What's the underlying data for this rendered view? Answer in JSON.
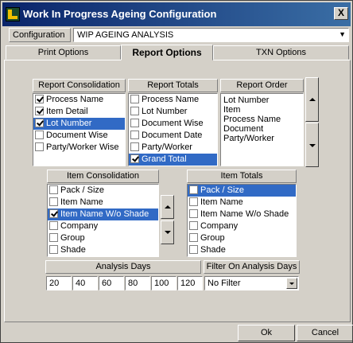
{
  "window": {
    "title": "Work In Progress Ageing Configuration",
    "close_glyph": "X"
  },
  "config": {
    "label": "Configuration",
    "value": "WIP AGEING ANALYSIS"
  },
  "tabs": [
    {
      "label": "Print Options"
    },
    {
      "label": "Report Options",
      "active": true
    },
    {
      "label": "TXN Options"
    }
  ],
  "report_consolidation": {
    "title": "Report Consolidation",
    "items": [
      {
        "label": "Process Name",
        "checked": true,
        "selected": false
      },
      {
        "label": "Item Detail",
        "checked": true,
        "selected": false
      },
      {
        "label": "Lot Number",
        "checked": true,
        "selected": true
      },
      {
        "label": "Document Wise",
        "checked": false,
        "selected": false
      },
      {
        "label": "Party/Worker Wise",
        "checked": false,
        "selected": false
      }
    ]
  },
  "report_totals": {
    "title": "Report Totals",
    "items": [
      {
        "label": "Process Name",
        "checked": false,
        "selected": false
      },
      {
        "label": "Lot Number",
        "checked": false,
        "selected": false
      },
      {
        "label": "Document Wise",
        "checked": false,
        "selected": false
      },
      {
        "label": "Document Date",
        "checked": false,
        "selected": false
      },
      {
        "label": "Party/Worker",
        "checked": false,
        "selected": false
      },
      {
        "label": "Grand Total",
        "checked": true,
        "selected": true
      }
    ]
  },
  "report_order": {
    "title": "Report Order",
    "items": [
      "Lot Number",
      "Item",
      "Process Name",
      "Document",
      "Party/Worker"
    ]
  },
  "item_consolidation": {
    "title": "Item Consolidation",
    "items": [
      {
        "label": "Pack / Size",
        "checked": false,
        "selected": false
      },
      {
        "label": "Item Name",
        "checked": false,
        "selected": false
      },
      {
        "label": "Item Name W/o Shade",
        "checked": true,
        "selected": true
      },
      {
        "label": "Company",
        "checked": false,
        "selected": false
      },
      {
        "label": "Group",
        "checked": false,
        "selected": false
      },
      {
        "label": "Shade",
        "checked": false,
        "selected": false
      }
    ]
  },
  "item_totals": {
    "title": "Item Totals",
    "items": [
      {
        "label": "Pack / Size",
        "checked": false,
        "selected": true
      },
      {
        "label": "Item Name",
        "checked": false,
        "selected": false
      },
      {
        "label": "Item Name W/o Shade",
        "checked": false,
        "selected": false
      },
      {
        "label": "Company",
        "checked": false,
        "selected": false
      },
      {
        "label": "Group",
        "checked": false,
        "selected": false
      },
      {
        "label": "Shade",
        "checked": false,
        "selected": false
      }
    ]
  },
  "analysis_days": {
    "title": "Analysis Days",
    "values": [
      "20",
      "40",
      "60",
      "80",
      "100",
      "120"
    ]
  },
  "filter": {
    "title": "Filter On Analysis Days",
    "value": "No Filter"
  },
  "buttons": {
    "ok": "Ok",
    "cancel": "Cancel"
  }
}
